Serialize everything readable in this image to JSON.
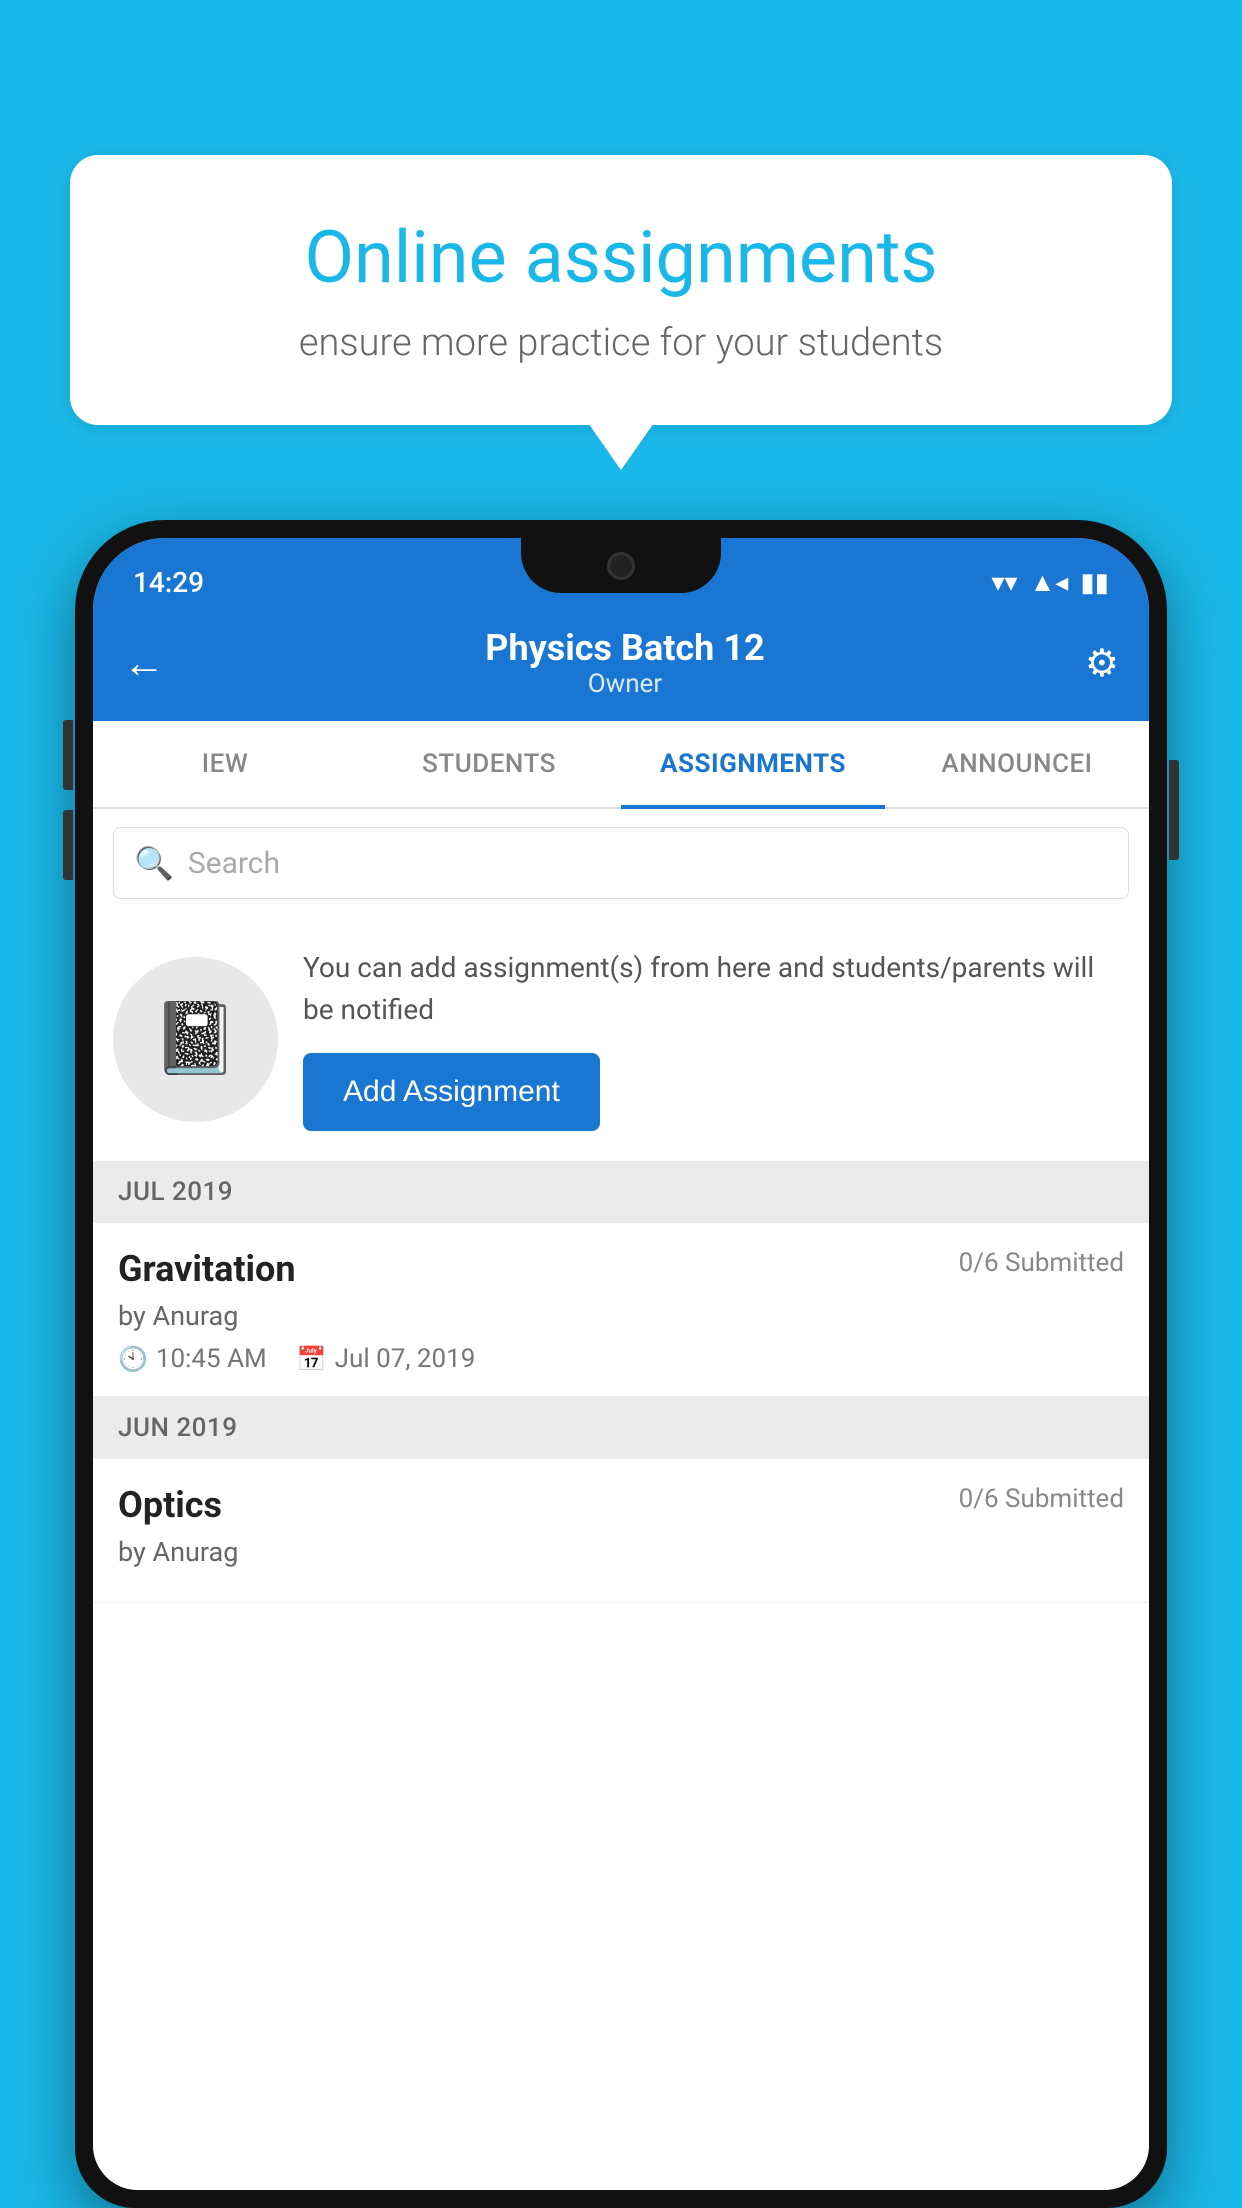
{
  "background": {
    "color": "#1ab8e8"
  },
  "speech_bubble": {
    "title": "Online assignments",
    "subtitle": "ensure more practice for your students"
  },
  "phone": {
    "status_bar": {
      "time": "14:29",
      "wifi_icon": "▾",
      "signal_icon": "◂",
      "battery_icon": "▮"
    },
    "header": {
      "title": "Physics Batch 12",
      "subtitle": "Owner",
      "back_icon": "←",
      "settings_icon": "⚙"
    },
    "tabs": [
      {
        "label": "IEW",
        "active": false
      },
      {
        "label": "STUDENTS",
        "active": false
      },
      {
        "label": "ASSIGNMENTS",
        "active": true
      },
      {
        "label": "ANNOUNCEI",
        "active": false
      }
    ],
    "search": {
      "placeholder": "Search",
      "icon": "🔍"
    },
    "empty_state": {
      "description": "You can add assignment(s) from here and students/parents will be notified",
      "button_label": "Add Assignment"
    },
    "sections": [
      {
        "label": "JUL 2019",
        "assignments": [
          {
            "name": "Gravitation",
            "submitted": "0/6 Submitted",
            "by": "by Anurag",
            "time": "10:45 AM",
            "date": "Jul 07, 2019"
          }
        ]
      },
      {
        "label": "JUN 2019",
        "assignments": [
          {
            "name": "Optics",
            "submitted": "0/6 Submitted",
            "by": "by Anurag",
            "time": "",
            "date": ""
          }
        ]
      }
    ]
  }
}
